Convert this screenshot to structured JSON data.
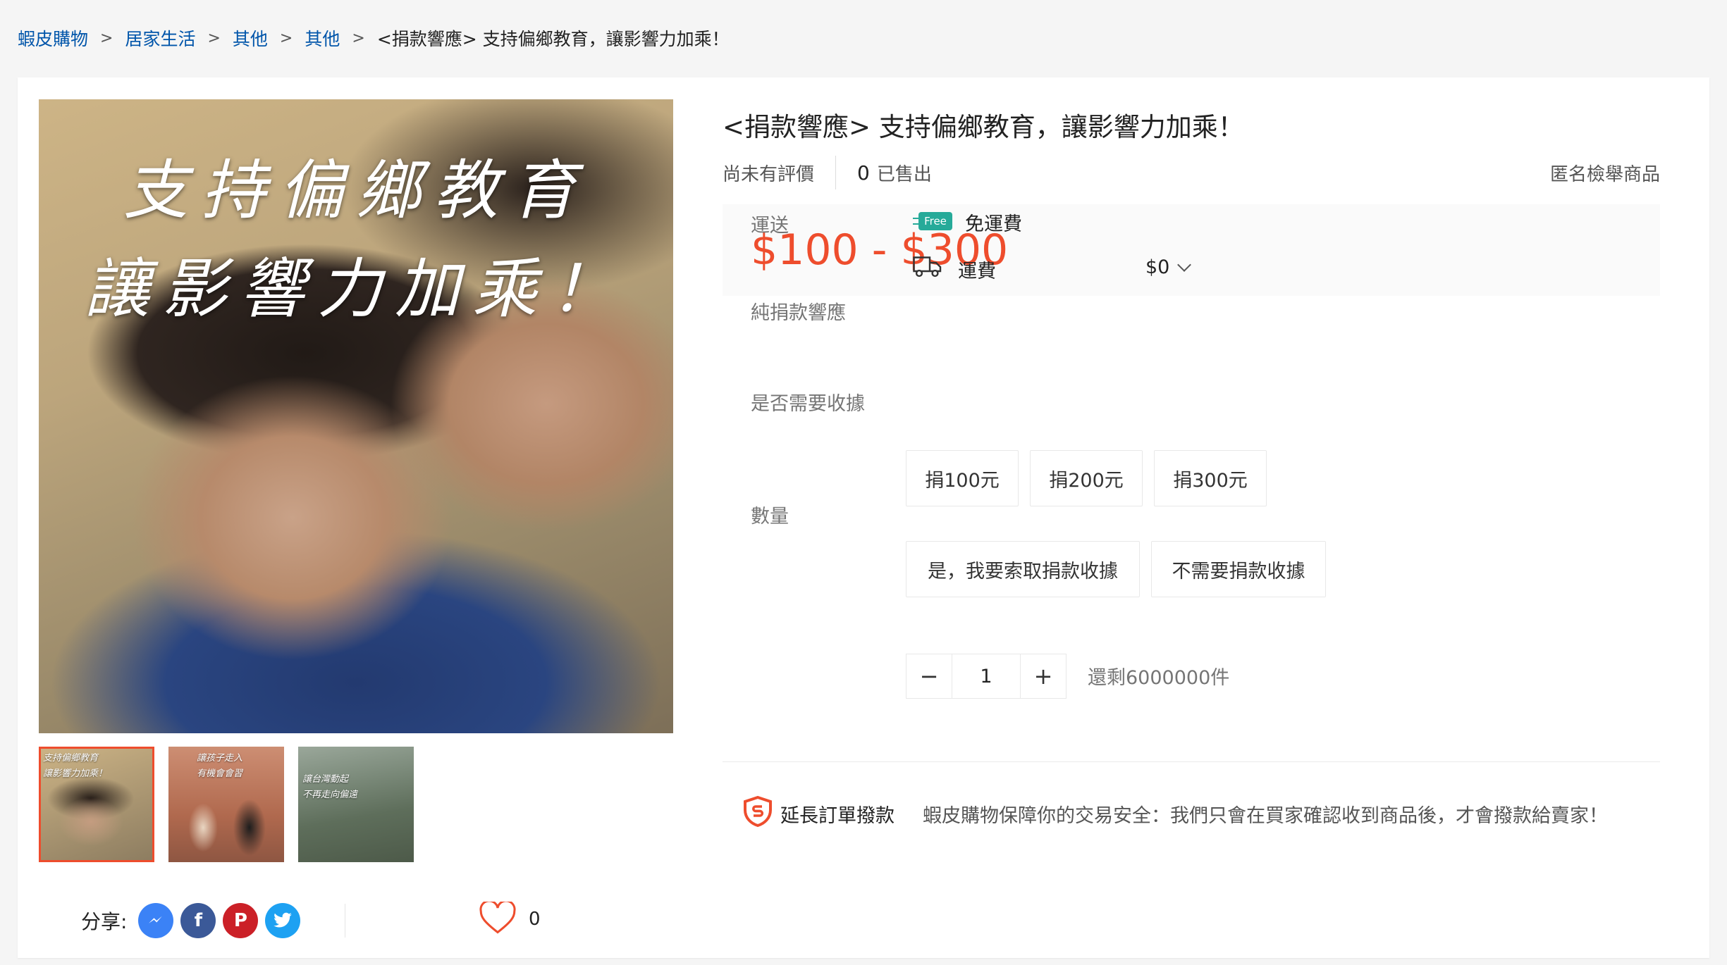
{
  "breadcrumb": {
    "items": [
      "蝦皮購物",
      "居家生活",
      "其他",
      "其他"
    ],
    "current": "<捐款響應> 支持偏鄉教育，讓影響力加乘！"
  },
  "gallery": {
    "main_caption_line1": "支持偏鄉教育",
    "main_caption_line2": "讓影響力加乘！",
    "thumbnails": [
      {
        "caption_line1": "支持偏鄉教育",
        "caption_line2": "讓影響力加乘！"
      },
      {
        "caption_line1": "讓孩子走入",
        "caption_line2": "有機會會習"
      },
      {
        "caption_line1": "讓台灣動起",
        "caption_line2": "不再走向偏遠"
      }
    ]
  },
  "share": {
    "label": "分享:",
    "icons": [
      "messenger-icon",
      "facebook-icon",
      "pinterest-icon",
      "twitter-icon"
    ]
  },
  "like": {
    "icon": "heart-icon",
    "count": "0"
  },
  "product": {
    "title": "<捐款響應> 支持偏鄉教育，讓影響力加乘！",
    "rating_text": "尚未有評價",
    "sold_count": "0",
    "sold_label": "已售出",
    "report_link": "匿名檢舉商品",
    "price": "$100 - $300",
    "price_color": "#ee4d2d"
  },
  "shipping": {
    "label": "運送",
    "free_badge": "Free",
    "free_text": "免運費",
    "fee_label": "運費",
    "fee_value": "$0"
  },
  "donation": {
    "label": "純捐款響應",
    "options": [
      "捐100元",
      "捐200元",
      "捐300元"
    ]
  },
  "receipt": {
    "label": "是否需要收據",
    "options": [
      "是，我要索取捐款收據",
      "不需要捐款收據"
    ]
  },
  "quantity": {
    "label": "數量",
    "minus": "−",
    "value": "1",
    "plus": "+",
    "stock": "還剩6000000件"
  },
  "guarantee": {
    "icon": "shield-icon",
    "label": "延長訂單撥款",
    "text": "蝦皮購物保障你的交易安全：我們只會在買家確認收到商品後，才會撥款給賣家！"
  }
}
